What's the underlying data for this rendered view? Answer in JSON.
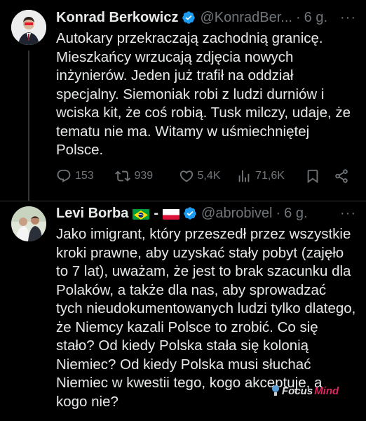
{
  "tweets": [
    {
      "name": "Konrad Berkowicz",
      "handle": "@KonradBer...",
      "time": "6 g.",
      "text": "Autokary przekraczają zachodnią granicę. Mieszkańcy wrzucają zdjęcia nowych inżynierów. Jeden już trafił na oddział specjalny. Siemoniak robi z ludzi durniów i wciska kit, że coś robią. Tusk milczy, udaje, że tematu nie ma. Witamy w uśmiechniętej Polsce.",
      "replies": "153",
      "reposts": "939",
      "likes": "5,4K",
      "views": "71,6K"
    },
    {
      "name": "Levi Borba",
      "name_sep": "-",
      "handle": "@abrobivel",
      "time": "6 g.",
      "text": "Jako imigrant, który przeszedł przez wszystkie kroki prawne, aby uzyskać stały pobyt (zajęło to 7 lat), uważam, że jest to brak szacunku dla Polaków, a także dla nas, aby sprowadzać tych nieudokumentowanych ludzi tylko dlatego, że Niemcy kazali Polsce to zrobić. Co się stało? Od kiedy Polska stała się kolonią Niemiec? Od kiedy Polska musi słuchać Niemiec w kwestii tego, kogo akceptuje, a kogo nie?"
    }
  ],
  "icons": {
    "verified": "verified-badge-icon",
    "reply": "reply-icon",
    "repost": "repost-icon",
    "like": "heart-icon",
    "views": "views-icon",
    "bookmark": "bookmark-icon",
    "share": "share-icon",
    "more": "more-icon"
  },
  "colors": {
    "background": "#000000",
    "text": "#e7e9ea",
    "muted": "#71767b",
    "verified": "#1d9bf0"
  },
  "watermark": {
    "brand_part1": "Focus",
    "brand_part2": "Mind"
  }
}
